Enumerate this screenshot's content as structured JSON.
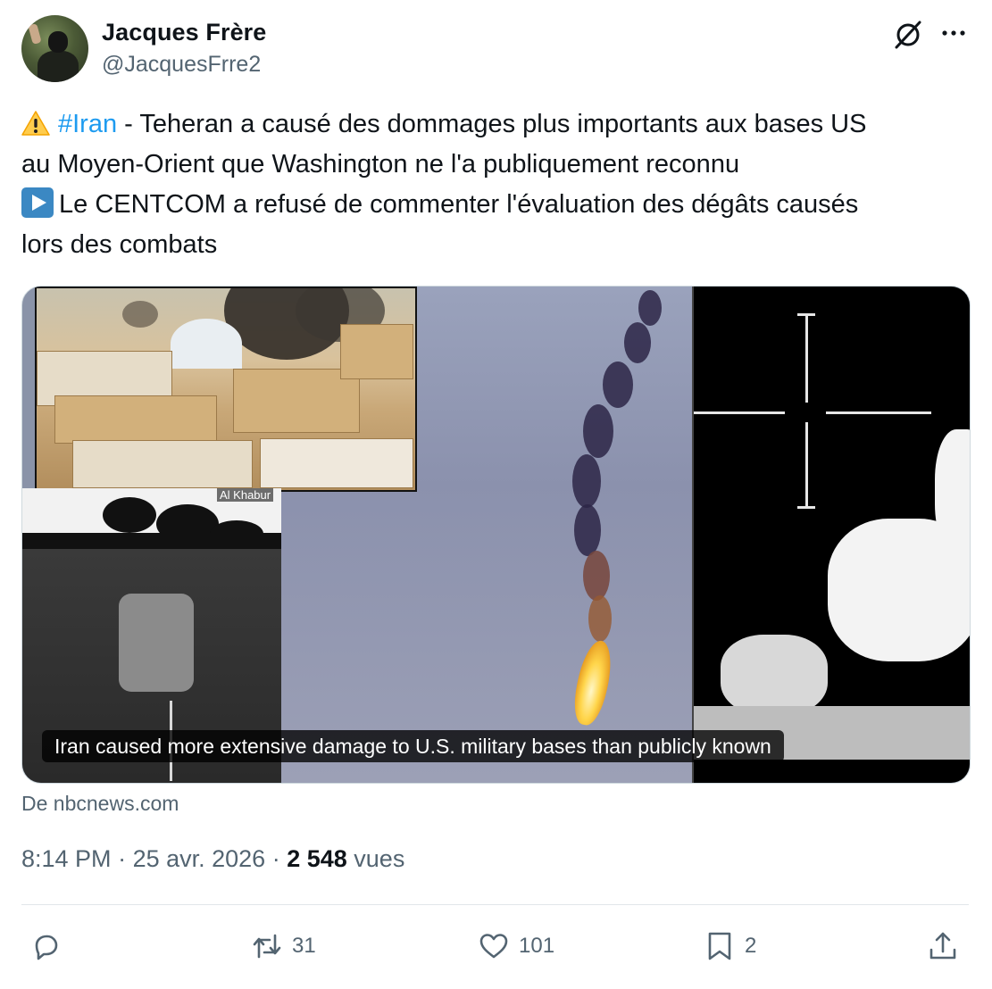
{
  "author": {
    "name": "Jacques Frère",
    "handle": "@JacquesFrre2"
  },
  "header_icons": [
    "grok-icon",
    "more-icon"
  ],
  "tweet": {
    "hashtag": "#Iran",
    "line1_rest": " - Teheran a causé des dommages plus importants aux bases US",
    "line2": "au Moyen-Orient que Washington ne l'a publiquement reconnu",
    "line3": "Le CENTCOM a refusé de commenter l'évaluation des dégâts causés",
    "line4": "lors des combats"
  },
  "media": {
    "overlay_label": "Al Khabur",
    "caption": "Iran caused more extensive damage to U.S. military bases than publicly known"
  },
  "source": "De nbcnews.com",
  "meta": {
    "time": "8:14 PM",
    "date": "25 avr. 2026",
    "views_count": "2 548",
    "views_label": "vues",
    "sep": " · "
  },
  "actions": {
    "reply": "",
    "retweet": "31",
    "like": "101",
    "bookmark": "2"
  },
  "colors": {
    "link": "#1d9bf0",
    "muted": "#536471",
    "text": "#0f1419"
  }
}
